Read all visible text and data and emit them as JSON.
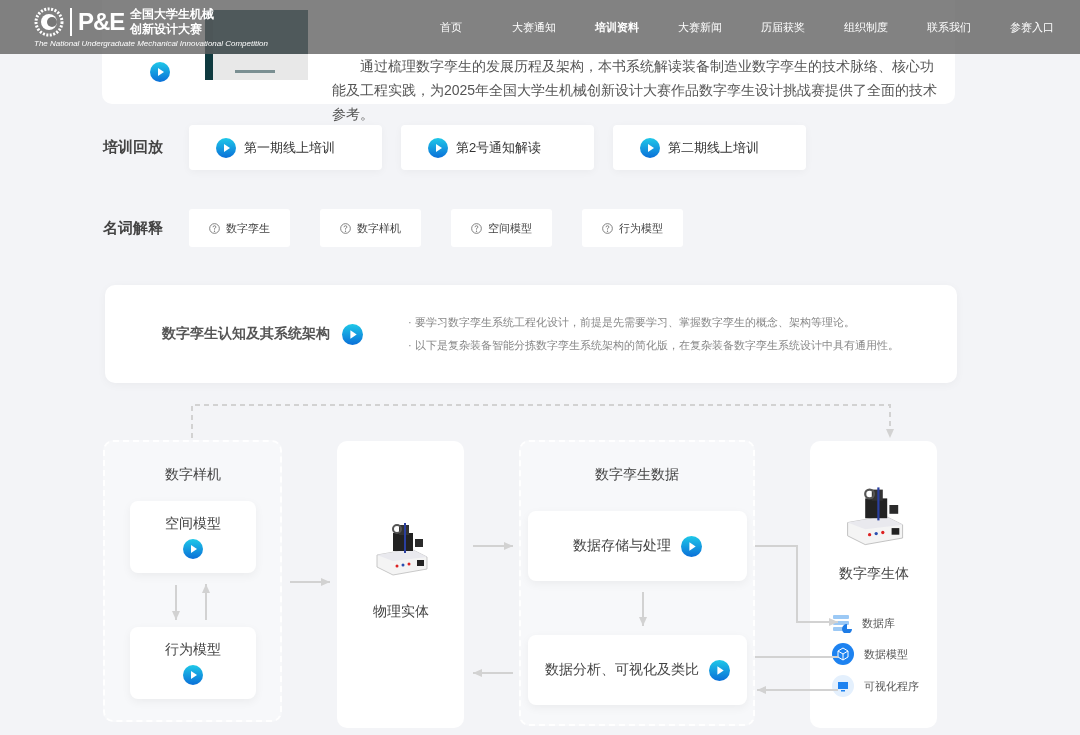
{
  "nav": {
    "logo": {
      "mark": "P&E",
      "title_lines": [
        "全国大学生机械",
        "创新设计大赛"
      ],
      "tagline": "The National Undergraduate Mechanical Innovational Competition"
    },
    "items": [
      {
        "label": "首页",
        "selected": false
      },
      {
        "label": "大赛通知",
        "selected": false
      },
      {
        "label": "培训资料",
        "selected": true
      },
      {
        "label": "大赛新闻",
        "selected": false
      },
      {
        "label": "历届获奖",
        "selected": false
      },
      {
        "label": "组织制度",
        "selected": false
      },
      {
        "label": "联系我们",
        "selected": false
      },
      {
        "label": "参赛入口",
        "selected": false
      }
    ]
  },
  "intro": {
    "text": "通过梳理数字孪生的发展历程及架构，本书系统解读装备制造业数字孪生的技术脉络、核心功能及工程实践，为2025年全国大学生机械创新设计大赛作品数字孪生设计挑战赛提供了全面的技术参考。"
  },
  "replays": {
    "label": "培训回放",
    "items": [
      "第一期线上培训",
      "第2号通知解读",
      "第二期线上培训"
    ]
  },
  "glossary": {
    "label": "名词解释",
    "items": [
      "数字孪生",
      "数字样机",
      "空间模型",
      "行为模型"
    ]
  },
  "architecture": {
    "title": "数字孪生认知及其系统架构",
    "notes": [
      "· 要学习数字孪生系统工程化设计，前提是先需要学习、掌握数字孪生的概念、架构等理论。",
      "· 以下是复杂装备智能分拣数字孪生系统架构的简化版，在复杂装备数字孪生系统设计中具有通用性。"
    ]
  },
  "diagram": {
    "digital_prototype": {
      "title": "数字样机",
      "items": [
        "空间模型",
        "行为模型"
      ]
    },
    "physical": {
      "title": "物理实体"
    },
    "twin_data": {
      "title": "数字孪生数据",
      "items": [
        "数据存储与处理",
        "数据分析、可视化及类比"
      ]
    },
    "twin": {
      "title": "数字孪生体",
      "items": [
        {
          "kind": "database",
          "label": "数据库"
        },
        {
          "kind": "model",
          "label": "数据模型"
        },
        {
          "kind": "program",
          "label": "可视化程序"
        }
      ]
    }
  }
}
